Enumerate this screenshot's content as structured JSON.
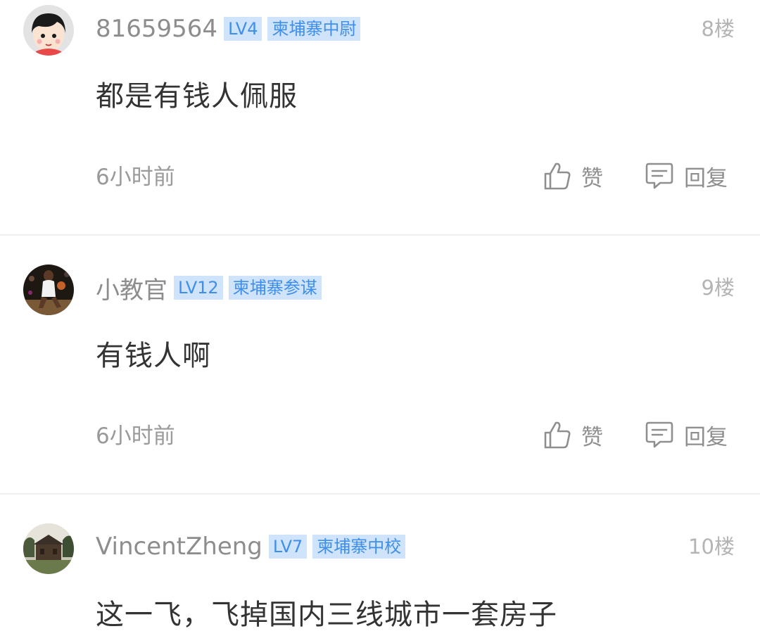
{
  "comments": [
    {
      "username": "81659564",
      "level": "LV4",
      "rank": "柬埔寨中尉",
      "floor": "8楼",
      "content": "都是有钱人佩服",
      "time": "6小时前",
      "like_label": "赞",
      "reply_label": "回复",
      "avatar_icon": "cartoon-face-avatar"
    },
    {
      "username": "小教官",
      "level": "LV12",
      "rank": "柬埔寨参谋",
      "floor": "9楼",
      "content": "有钱人啊",
      "time": "6小时前",
      "like_label": "赞",
      "reply_label": "回复",
      "avatar_icon": "basketball-player-avatar"
    },
    {
      "username": "VincentZheng",
      "level": "LV7",
      "rank": "柬埔寨中校",
      "floor": "10楼",
      "content": "这一飞，飞掉国内三线城市一套房子",
      "avatar_icon": "wooden-house-avatar"
    }
  ],
  "colors": {
    "badge_bg": "#cfe3fa",
    "badge_text": "#3f8fea",
    "username": "#8d8d8d",
    "content": "#333333",
    "meta": "#9a9a9a"
  }
}
